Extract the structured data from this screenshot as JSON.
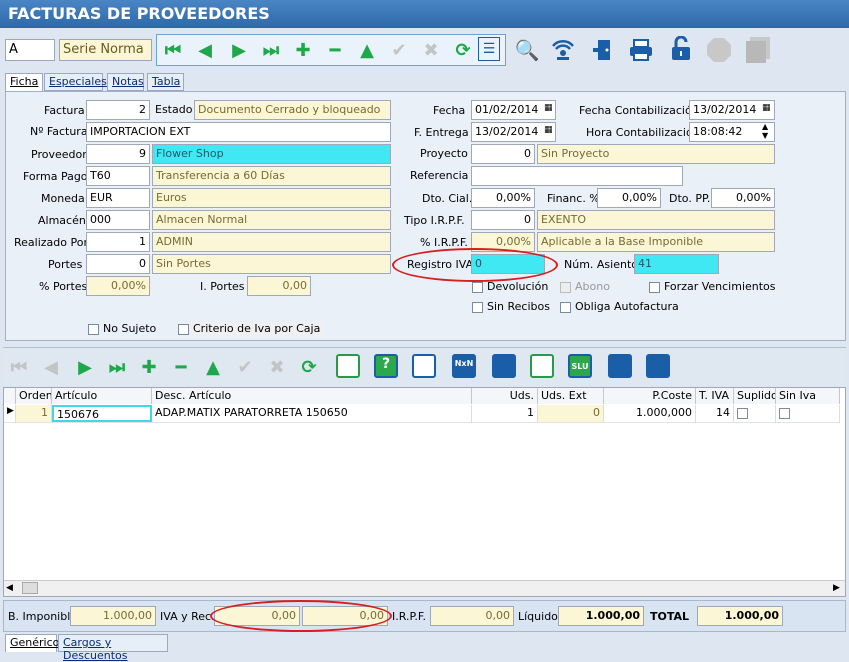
{
  "window": {
    "title": "FACTURAS DE PROVEEDORES"
  },
  "header": {
    "serie_code": "A",
    "serie_name": "Serie Norma"
  },
  "tabs": [
    "Ficha",
    "Especiales",
    "Notas",
    "Tabla"
  ],
  "form": {
    "factura": {
      "label": "Factura",
      "value": "2"
    },
    "estado": {
      "label": "Estado",
      "value": "Documento Cerrado y bloqueado"
    },
    "num_factura": {
      "label": "Nº Factura",
      "value": "IMPORTACION EXT"
    },
    "proveedor": {
      "label": "Proveedor",
      "code": "9",
      "name": "Flower Shop"
    },
    "forma_pago": {
      "label": "Forma Pago",
      "code": "T60",
      "name": "Transferencia a 60 Días"
    },
    "moneda": {
      "label": "Moneda",
      "code": "EUR",
      "name": "Euros"
    },
    "almacen": {
      "label": "Almacén",
      "code": "000",
      "name": "Almacen Normal"
    },
    "realizado_por": {
      "label": "Realizado Por",
      "code": "1",
      "name": "ADMIN"
    },
    "portes": {
      "label": "Portes",
      "code": "0",
      "name": "Sin Portes"
    },
    "pct_portes": {
      "label": "% Portes",
      "value": "0,00%"
    },
    "i_portes": {
      "label": "I. Portes",
      "value": "0,00"
    },
    "fecha": {
      "label": "Fecha",
      "value": "01/02/2014"
    },
    "f_entrega": {
      "label": "F. Entrega",
      "value": "13/02/2014"
    },
    "fecha_contab": {
      "label": "Fecha Contabilización",
      "value": "13/02/2014"
    },
    "hora_contab": {
      "label": "Hora Contabilización",
      "value": "18:08:42"
    },
    "proyecto": {
      "label": "Proyecto",
      "code": "0",
      "name": "Sin Proyecto"
    },
    "referencia": {
      "label": "Referencia",
      "value": ""
    },
    "dto_cial": {
      "label": "Dto. Cial.",
      "value": "0,00%"
    },
    "financ": {
      "label": "Financ. %",
      "value": "0,00%"
    },
    "dto_pp": {
      "label": "Dto. PP.",
      "value": "0,00%"
    },
    "tipo_irpf": {
      "label": "Tipo I.R.P.F.",
      "code": "0",
      "name": "EXENTO"
    },
    "pct_irpf": {
      "label": "% I.R.P.F.",
      "value": "0,00%",
      "name": "Aplicable a la Base Imponible"
    },
    "registro_iva": {
      "label": "Registro IVA",
      "value": "0"
    },
    "num_asiento": {
      "label": "Núm. Asiento",
      "value": "41"
    },
    "checks": {
      "devolucion": "Devolución",
      "abono": "Abono",
      "forzar": "Forzar Vencimientos",
      "sin_recibos": "Sin Recibos",
      "obliga": "Obliga Autofactura",
      "no_sujeto": "No Sujeto",
      "criterio": "Criterio de Iva por Caja"
    }
  },
  "grid": {
    "columns": [
      "Orden",
      "Artículo",
      "Desc. Artículo",
      "Uds.",
      "Uds. Ext",
      "P.Coste",
      "T. IVA",
      "Suplido",
      "Sin Iva"
    ],
    "rows": [
      {
        "orden": "1",
        "articulo": "150676",
        "desc": "ADAP.MATIX PARATORRETA  150650",
        "uds": "1",
        "uds_ext": "0",
        "pcoste": "1.000,000",
        "tiva": "14"
      }
    ]
  },
  "totals": {
    "b_imponible_label": "B. Imponible",
    "b_imponible": "1.000,00",
    "iva_label": "IVA y Rec.",
    "iva": "0,00",
    "rec": "0,00",
    "irpf_label": "I.R.P.F.",
    "irpf": "0,00",
    "liquido_label": "Líquido",
    "liquido": "1.000,00",
    "total_label": "TOTAL",
    "total": "1.000,00"
  },
  "bottom_tabs": [
    "Genérico",
    "Cargos y Descuentos"
  ]
}
